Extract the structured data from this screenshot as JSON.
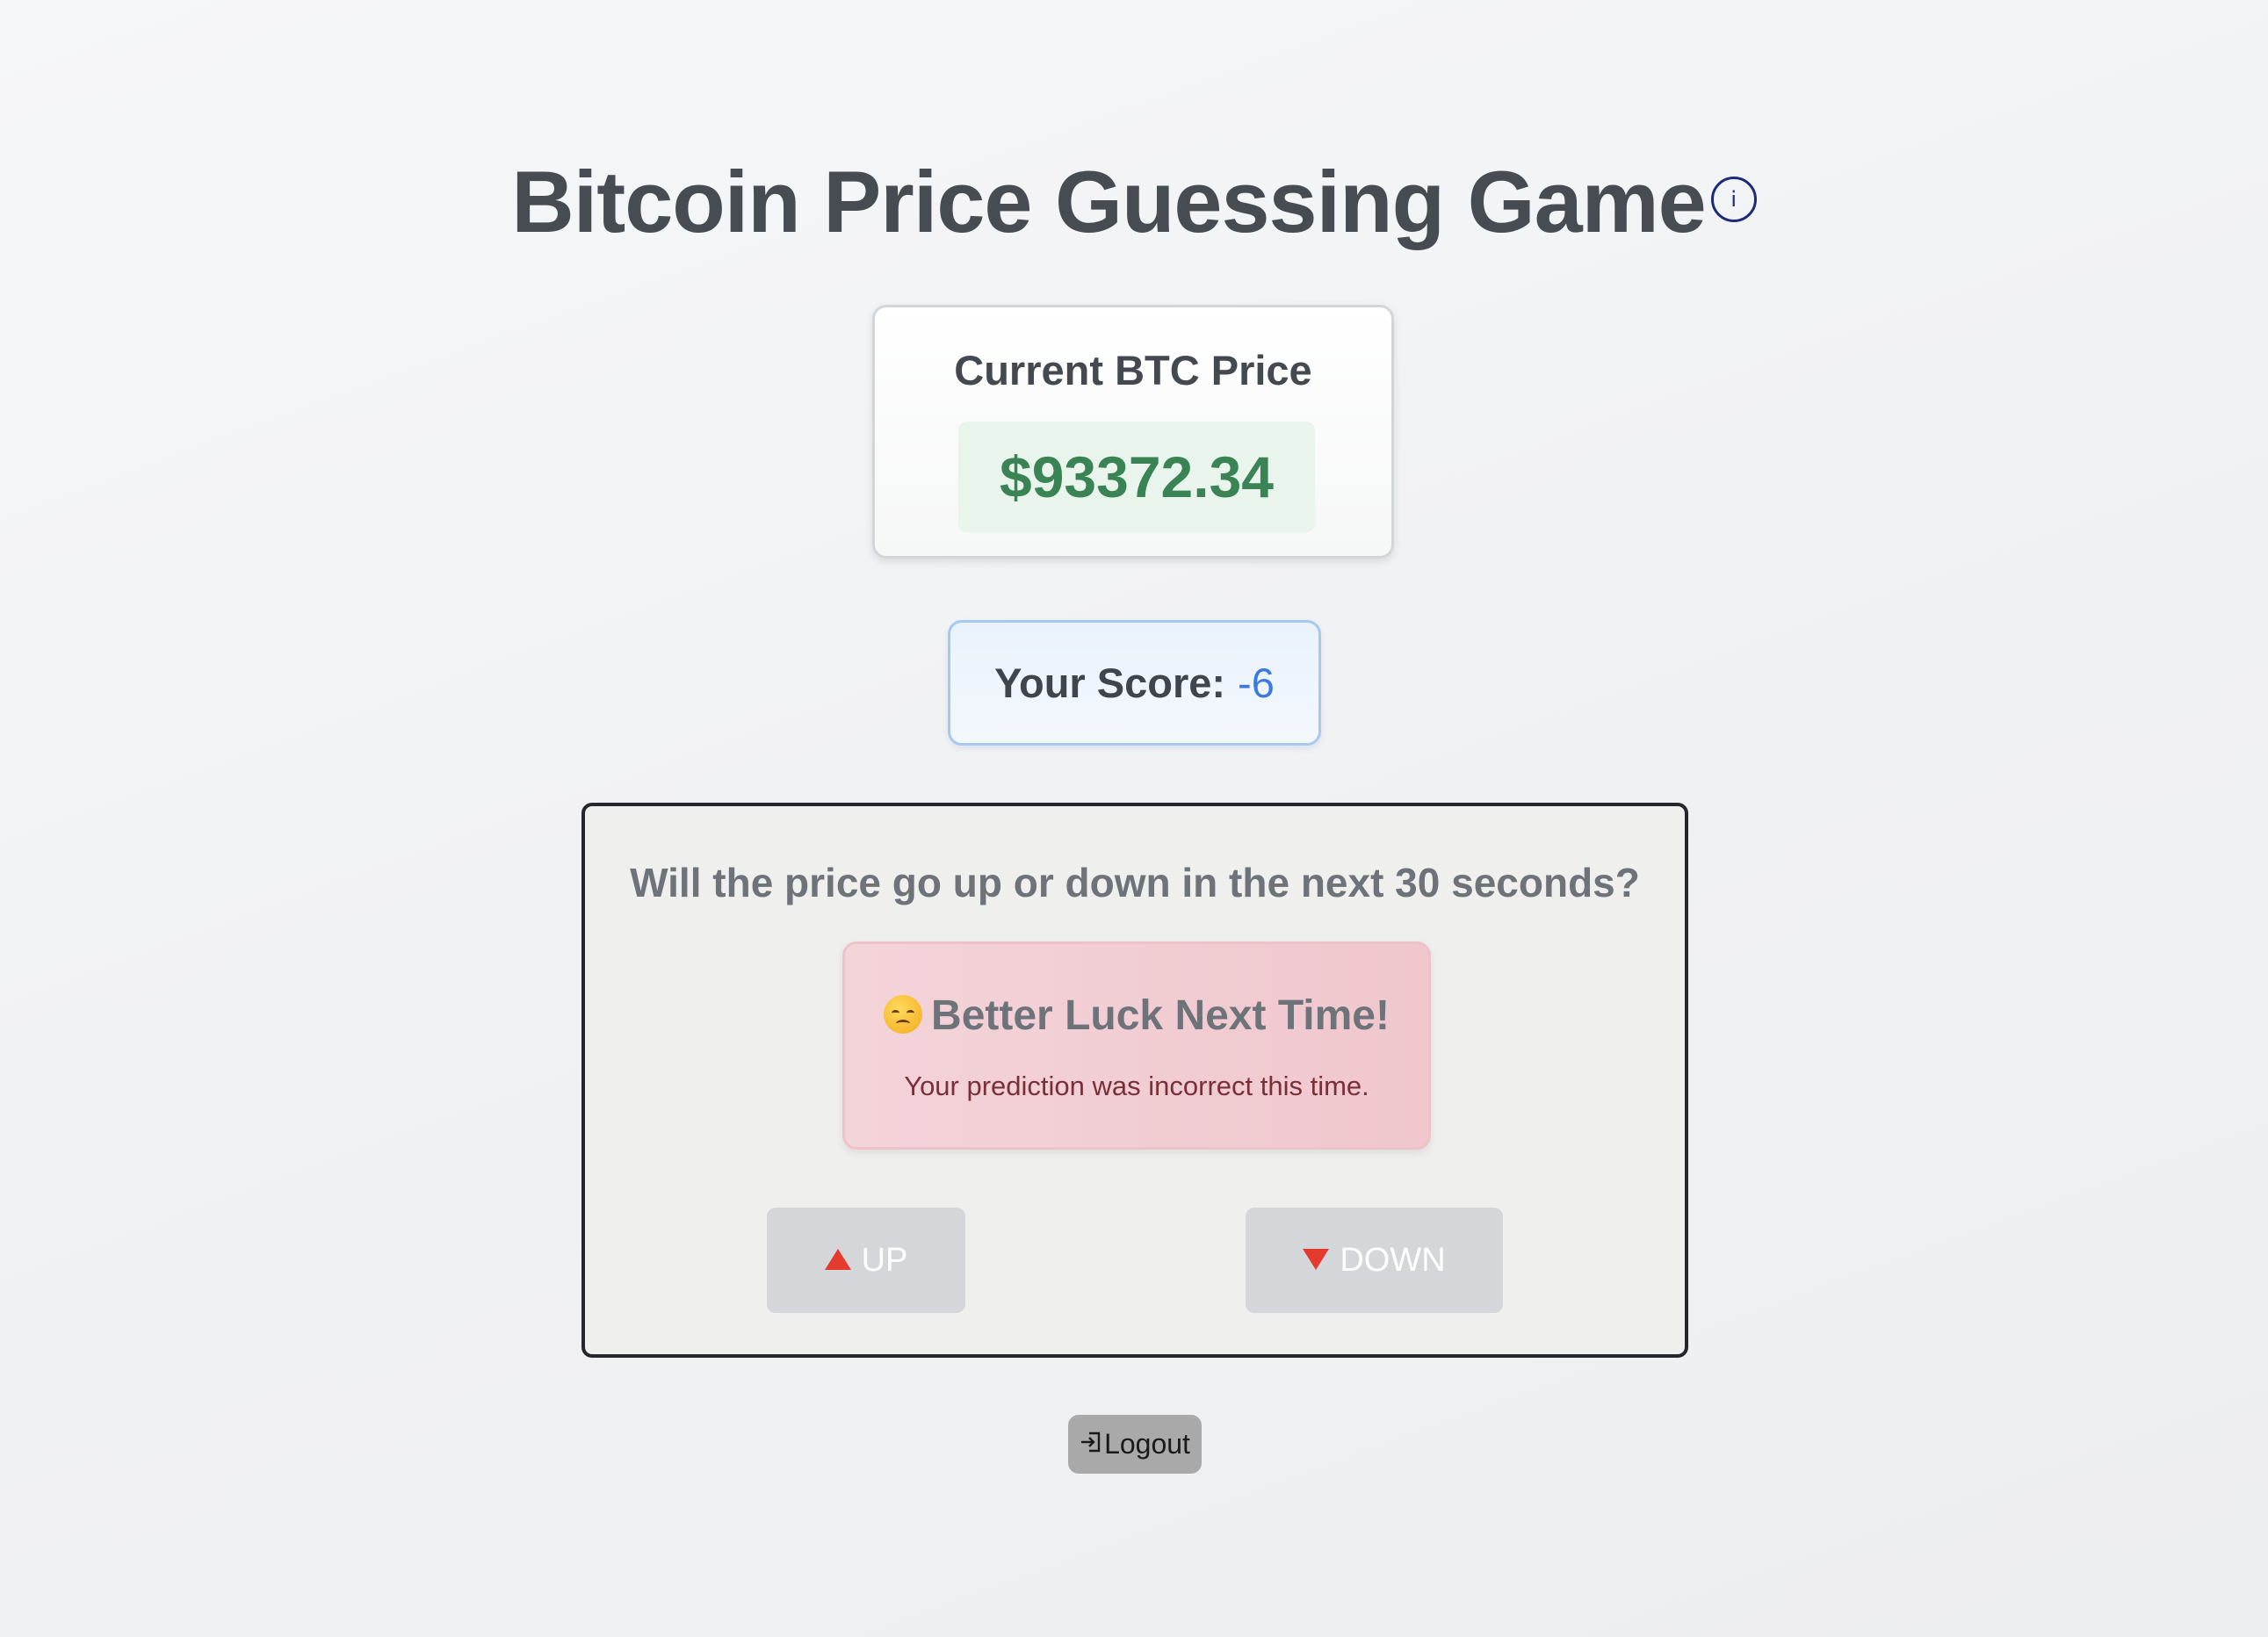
{
  "header": {
    "title": "Bitcoin Price Guessing Game",
    "info_icon": "info-icon"
  },
  "price": {
    "label": "Current BTC Price",
    "value": "$93372.34"
  },
  "score": {
    "label": "Your Score:",
    "value": "-6"
  },
  "game": {
    "question": "Will the price go up or down in the next 30 seconds?",
    "result": {
      "emoji": "disappointed-face-icon",
      "title": "Better Luck Next Time!",
      "message": "Your prediction was incorrect this time."
    },
    "up_button": {
      "label": "UP",
      "icon": "red-triangle-up-icon",
      "enabled": false
    },
    "down_button": {
      "label": "DOWN",
      "icon": "red-triangle-down-icon",
      "enabled": false
    }
  },
  "logout": {
    "label": "Logout",
    "icon": "logout-icon"
  },
  "colors": {
    "title": "#474c53",
    "price_green": "#3a8354",
    "score_blue": "#3b7be0",
    "result_bg": "#f2cfd4",
    "button_disabled": "#d4d6da",
    "arrow_red": "#e53a2e",
    "logout_bg": "#a9a9a9"
  }
}
